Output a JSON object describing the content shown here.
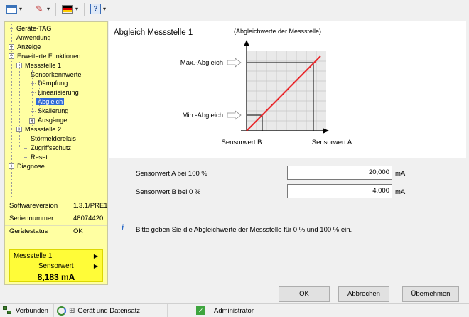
{
  "toolbar": {
    "icons": [
      "window-icon",
      "wrench-icon",
      "flag-icon",
      "help-icon"
    ],
    "help_label": "?"
  },
  "tree": {
    "items": [
      {
        "label": "Geräte-TAG",
        "id": "geraete-tag"
      },
      {
        "label": "Anwendung",
        "id": "anwendung"
      },
      {
        "label": "Anzeige",
        "id": "anzeige",
        "toggle": "+"
      },
      {
        "label": "Erweiterte Funktionen",
        "id": "erweiterte-funktionen",
        "toggle": "−"
      },
      {
        "label": "Messstelle 1",
        "id": "messstelle-1",
        "toggle": "−"
      },
      {
        "label": "Sensorkennwerte",
        "id": "sensorkennwerte"
      },
      {
        "label": "Dämpfung",
        "id": "daempfung"
      },
      {
        "label": "Linearisierung",
        "id": "linearisierung"
      },
      {
        "label": "Abgleich",
        "id": "abgleich",
        "selected": true
      },
      {
        "label": "Skalierung",
        "id": "skalierung"
      },
      {
        "label": "Ausgänge",
        "id": "ausgaenge",
        "toggle": "+"
      },
      {
        "label": "Messstelle 2",
        "id": "messstelle-2",
        "toggle": "+"
      },
      {
        "label": "Störmelderelais",
        "id": "stoermelderelais"
      },
      {
        "label": "Zugriffsschutz",
        "id": "zugriffsschutz"
      },
      {
        "label": "Reset",
        "id": "reset"
      },
      {
        "label": "Diagnose",
        "id": "diagnose",
        "toggle": "+"
      }
    ]
  },
  "device_info": {
    "software_label": "Softwareversion",
    "software_value": "1.3.1/PRE1",
    "serial_label": "Seriennummer",
    "serial_value": "48074420",
    "status_label": "Gerätestatus",
    "status_value": "OK"
  },
  "live": {
    "point": "Messstelle 1",
    "quantity": "Sensorwert",
    "value": "8,183 mA"
  },
  "main": {
    "title": "Abgleich Messstelle 1",
    "diagram": {
      "caption": "(Abgleichwerte der Messstelle)",
      "max_label": "Max.-Abgleich",
      "min_label": "Min.-Abgleich",
      "sensor_b_label": "Sensorwert B",
      "sensor_a_label": "Sensorwert A",
      "line_color": "#e8262a"
    },
    "fields": [
      {
        "label": "Sensorwert A bei 100 %",
        "value": "20,000",
        "unit": "mA"
      },
      {
        "label": "Sensorwert B bei 0 %",
        "value": "4,000",
        "unit": "mA"
      }
    ],
    "hint": "Bitte geben Sie die Abgleichwerte der Messstelle für 0 % und 100 % ein.",
    "hint_icon": "info-icon"
  },
  "buttons": {
    "ok": "OK",
    "cancel": "Abbrechen",
    "apply": "Übernehmen"
  },
  "statusbar": {
    "connection": "Verbunden",
    "device_data": "Gerät und Datensatz",
    "user": "Administrator"
  }
}
